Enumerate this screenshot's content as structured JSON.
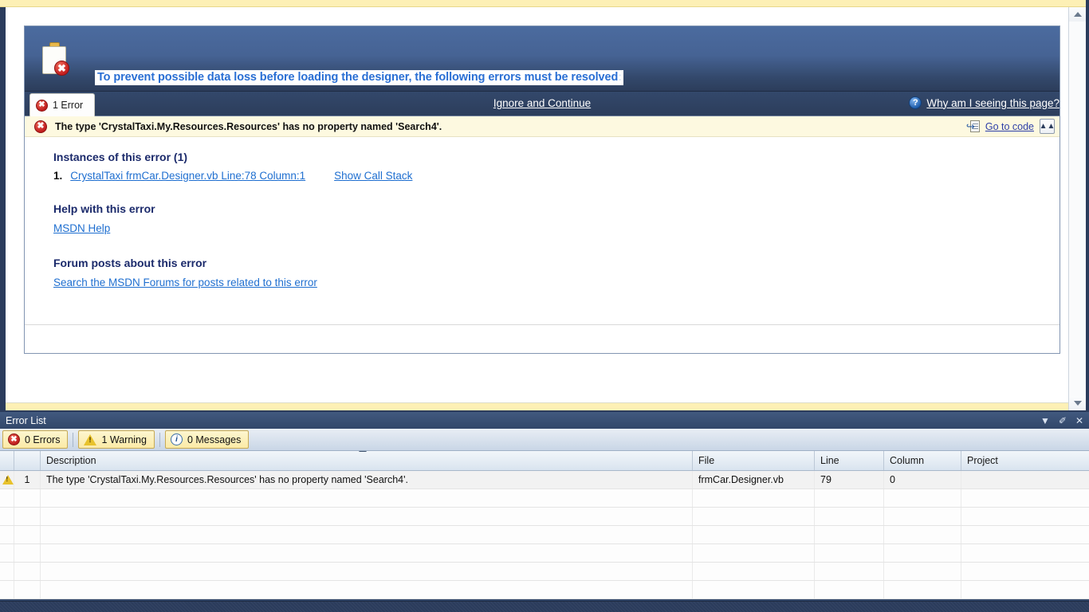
{
  "designer_error_page": {
    "banner": {
      "clipboard_icon": "clipboard-error-icon",
      "title_main": "To prevent possible data loss before loading the designer, the following errors must be resolved",
      "title_trailing": ":"
    },
    "tabs": [
      {
        "label": "1 Error",
        "icon": "error-icon",
        "active": true
      }
    ],
    "ignore_and_continue_label": "Ignore and Continue",
    "why_link": {
      "icon": "help-circle-icon",
      "label": "Why am I seeing this page?"
    },
    "error_bar": {
      "icon": "error-icon",
      "message": "The type 'CrystalTaxi.My.Resources.Resources' has no property named 'Search4'.",
      "go_to_code_label": "Go to code",
      "go_to_code_icon": "go-to-code-icon",
      "collapse_icon": "chevron-double-up-icon"
    },
    "sections": {
      "instances_heading": "Instances of this error (1)",
      "instances": [
        {
          "number": "1.",
          "link": "CrystalTaxi frmCar.Designer.vb Line:78 Column:1",
          "call_stack_label": "Show Call Stack"
        }
      ],
      "help_heading": "Help with this error",
      "help_link": "MSDN Help",
      "forum_heading": "Forum posts about this error",
      "forum_link": "Search the MSDN Forums for posts related to this error"
    },
    "scrollbar": {
      "up_icon": "scroll-up-arrow-icon",
      "down_icon": "scroll-down-arrow-icon"
    }
  },
  "error_list_panel": {
    "title": "Error List",
    "window_buttons": [
      {
        "name": "dropdown",
        "glyph": "▼"
      },
      {
        "name": "pin",
        "glyph": "✐"
      },
      {
        "name": "close",
        "glyph": "✕"
      }
    ],
    "toolbar": [
      {
        "label": "0 Errors",
        "icon": "error-icon",
        "pressed": true
      },
      {
        "label": "1 Warning",
        "icon": "warning-icon",
        "pressed": true
      },
      {
        "label": "0 Messages",
        "icon": "info-icon",
        "pressed": true
      }
    ],
    "columns": [
      "",
      "",
      "Description",
      "File",
      "Line",
      "Column",
      "Project"
    ],
    "sort_column": "Description",
    "sort_direction": "ascending",
    "rows": [
      {
        "icon": "warning-icon",
        "number": "1",
        "description": "The type 'CrystalTaxi.My.Resources.Resources' has no property named 'Search4'.",
        "file": "frmCar.Designer.vb",
        "line": "79",
        "column": "0",
        "project": ""
      }
    ],
    "empty_row_count": 6
  },
  "colors": {
    "banner_top": "#4b6b9f",
    "banner_bottom": "#2c3d5b",
    "link_blue": "#1f6fd0",
    "heading_navy": "#1b2a6b",
    "error_bar_bg": "#fdf9e0",
    "toolbar_button_bg": "#fbeaa6",
    "error_red": "#bf1d1d",
    "warning_yellow": "#e8c22c",
    "chrome_navy": "#2b3c5c",
    "top_strip_yellow": "#fdf0b5"
  }
}
